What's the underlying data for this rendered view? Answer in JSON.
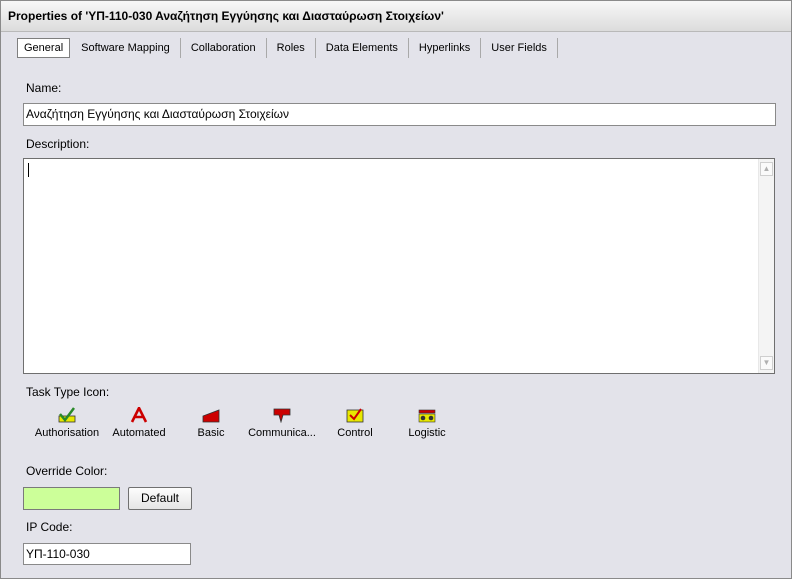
{
  "window": {
    "title": "Properties of 'ΥΠ-110-030 Αναζήτηση Εγγύησης και Διασταύρωση Στοιχείων'"
  },
  "tabs": [
    {
      "label": "General",
      "active": true
    },
    {
      "label": "Software Mapping"
    },
    {
      "label": "Collaboration"
    },
    {
      "label": "Roles"
    },
    {
      "label": "Data Elements"
    },
    {
      "label": "Hyperlinks"
    },
    {
      "label": "User Fields"
    }
  ],
  "form": {
    "name_label": "Name:",
    "name_value": "Αναζήτηση Εγγύησης και Διασταύρωση Στοιχείων",
    "description_label": "Description:",
    "description_value": "",
    "task_type_label": "Task Type Icon:",
    "task_types": [
      {
        "label": "Authorisation",
        "icon": "checkmark-icon"
      },
      {
        "label": "Automated",
        "icon": "letter-a-icon"
      },
      {
        "label": "Basic",
        "icon": "wedge-icon"
      },
      {
        "label": "Communica...",
        "icon": "message-icon"
      },
      {
        "label": "Control",
        "icon": "checkbox-icon"
      },
      {
        "label": "Logistic",
        "icon": "cart-icon"
      }
    ],
    "override_color_label": "Override Color:",
    "override_color": "#ccff99",
    "default_button": "Default",
    "ip_code_label": "IP Code:",
    "ip_code_value": "ΥΠ-110-030"
  },
  "colors": {
    "task_icon_red": "#cc0000",
    "task_icon_yellow": "#e8e800",
    "task_icon_green": "#2a8a2a"
  }
}
